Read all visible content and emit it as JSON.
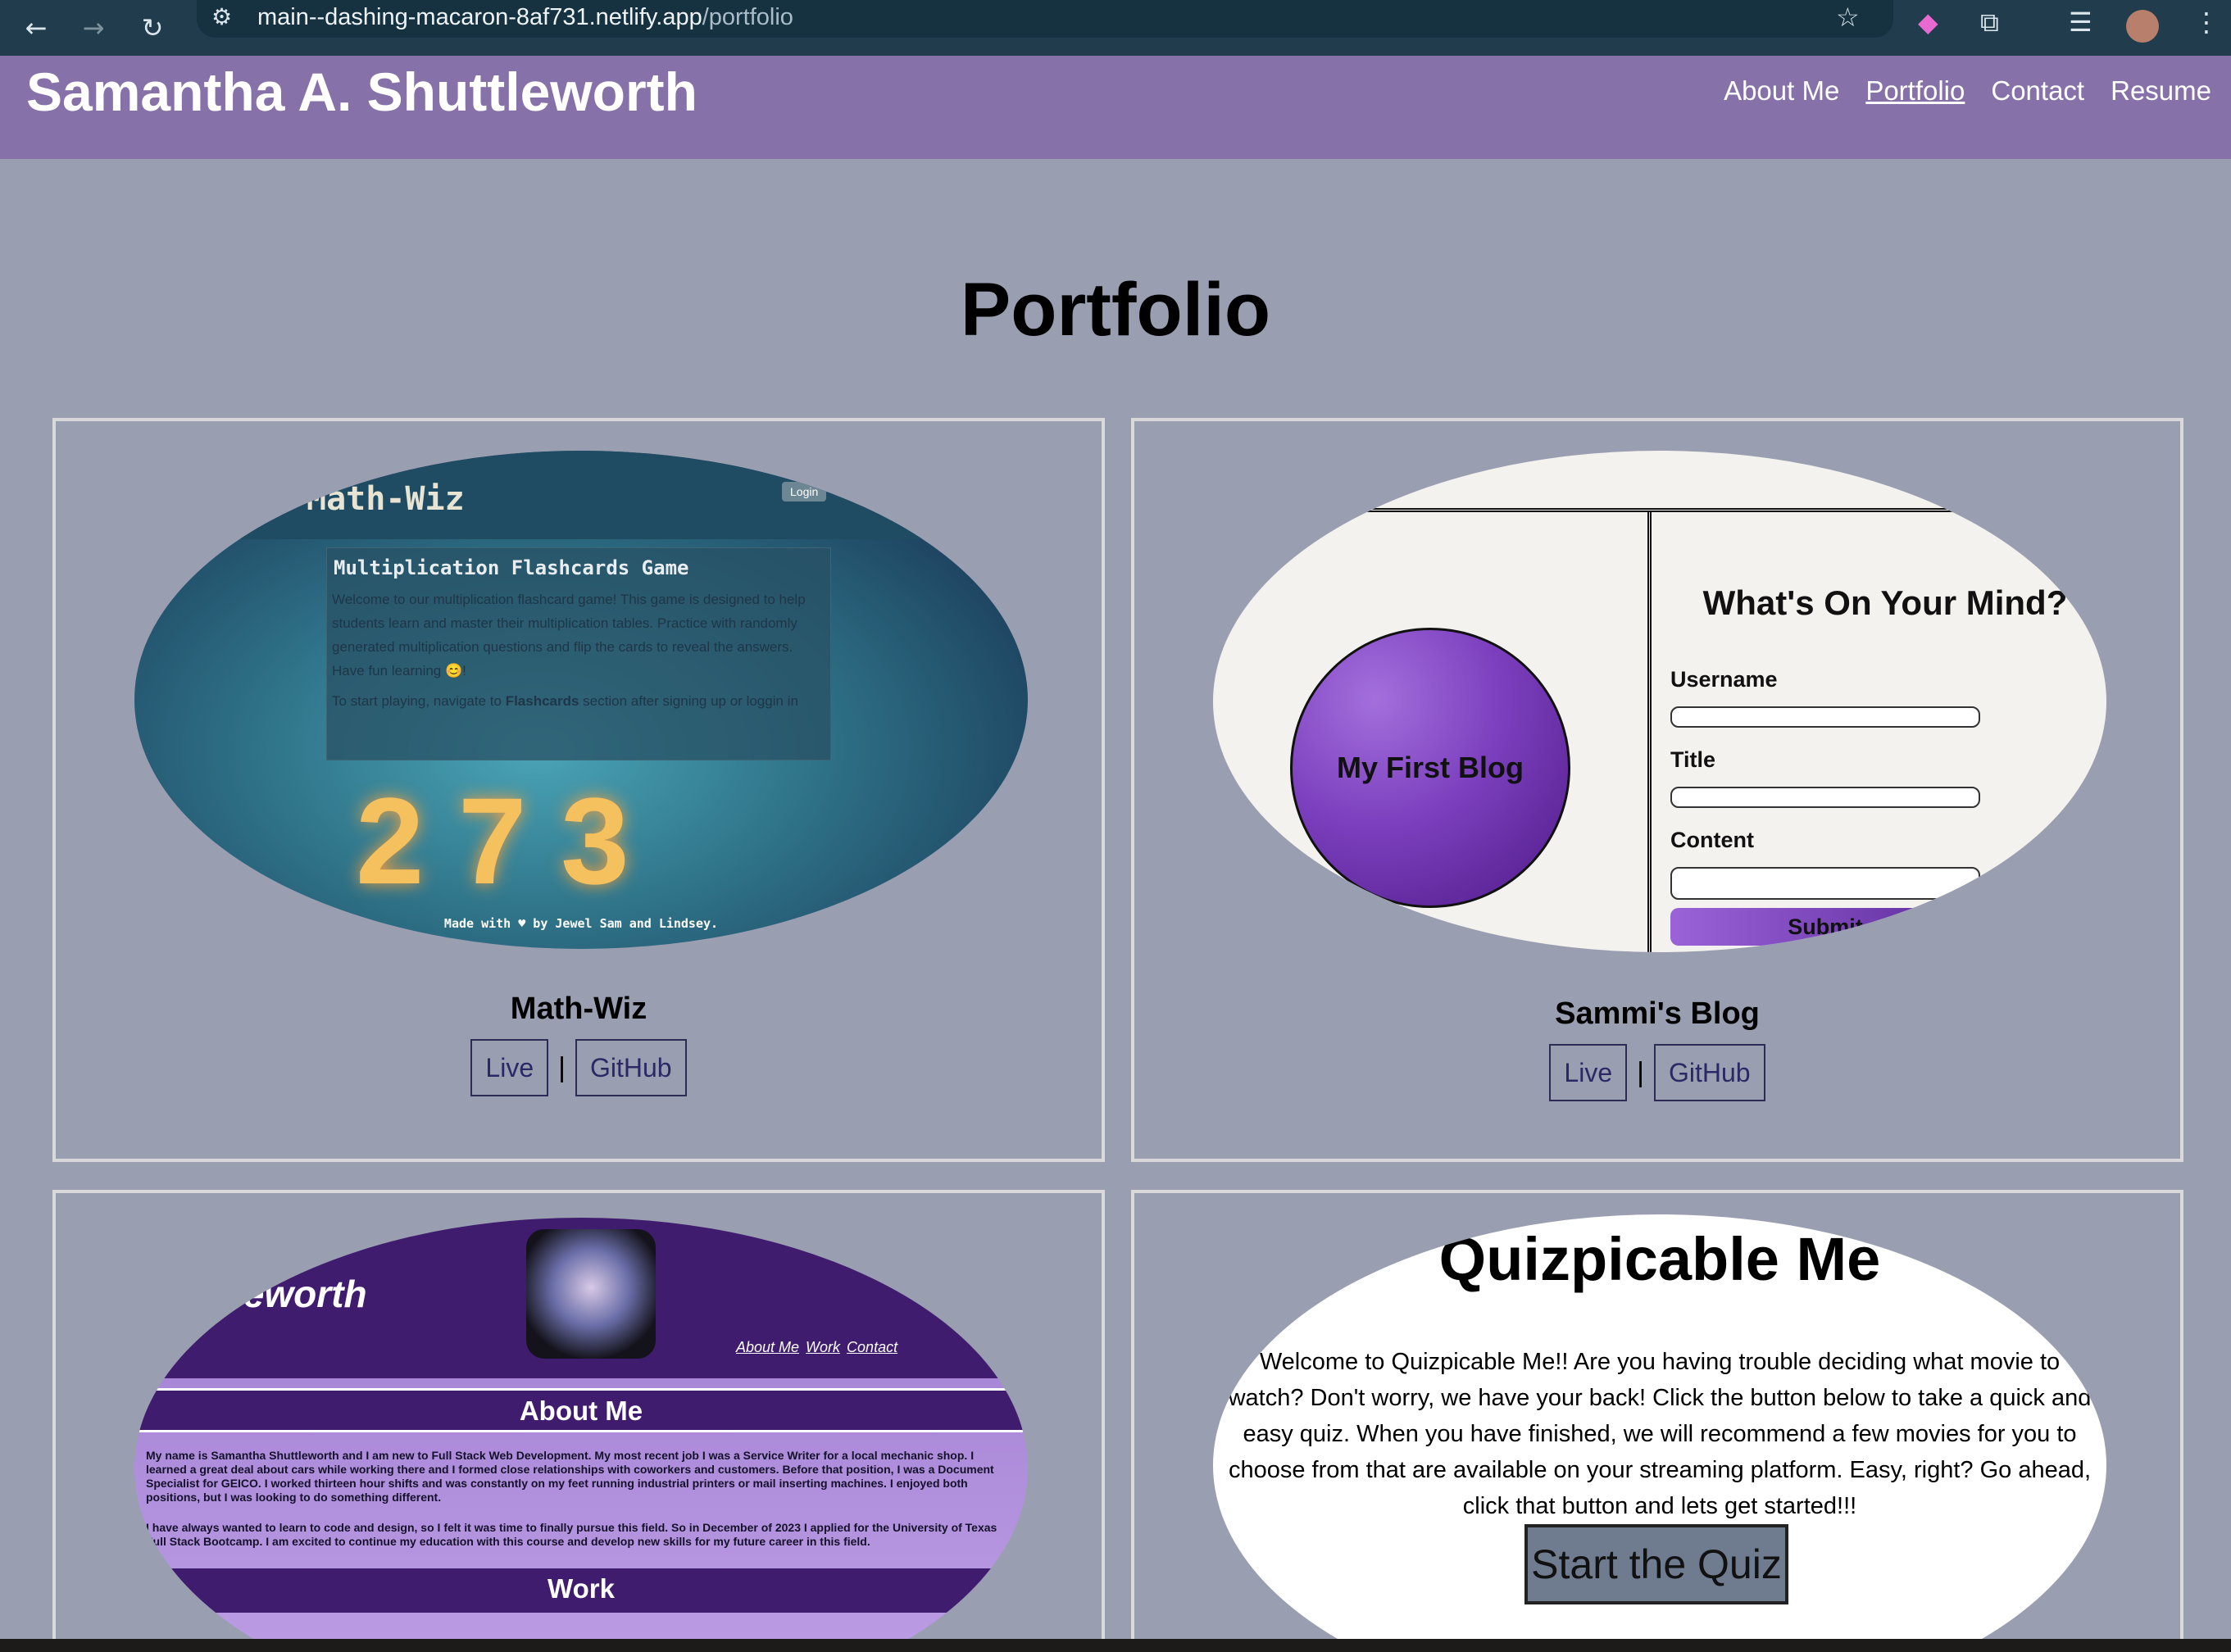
{
  "browser": {
    "url_host": "main--dashing-macaron-8af731.netlify.app",
    "url_path": "/portfolio"
  },
  "site": {
    "title": "Samantha A. Shuttleworth",
    "nav": [
      "About Me",
      "Portfolio",
      "Contact",
      "Resume"
    ],
    "active_nav": "Portfolio"
  },
  "page": {
    "heading": "Portfolio"
  },
  "projects": [
    {
      "title": "Math-Wiz",
      "live_label": "Live",
      "separator": "|",
      "github_label": "GitHub",
      "preview": {
        "app_name": "Math-Wiz",
        "login": "Login",
        "heading": "Multiplication Flashcards Game",
        "text1": "Welcome to our multiplication flashcard game! This game is designed to help students learn and master their multiplication tables. Practice with randomly generated multiplication questions and flip the cards to reveal the answers. Have fun learning 😊!",
        "text2_pre": "To start playing, navigate to ",
        "text2_strong": "Flashcards",
        "text2_post": " section after signing up or loggin in",
        "footer": "Made with ♥ by Jewel Sam and Lindsey."
      }
    },
    {
      "title": "Sammi's Blog",
      "live_label": "Live",
      "separator": "|",
      "github_label": "GitHub",
      "preview": {
        "circle_text": "My First Blog",
        "heading": "What's On Your Mind?",
        "username": "Username",
        "title": "Title",
        "content": "Content",
        "submit": "Submit"
      }
    },
    {
      "preview": {
        "name_fragment": "leworth",
        "links": [
          "About Me",
          "Work",
          "Contact"
        ],
        "about_heading": "About Me",
        "about_text1": "My name is Samantha Shuttleworth and I am new to Full Stack Web Development. My most recent job I was a Service Writer for a local mechanic shop. I learned a great deal about cars while working there and I formed close relationships with coworkers and customers. Before that position, I was a Document Specialist for GEICO. I worked thirteen hour shifts and was constantly on my feet running industrial printers or mail inserting machines. I enjoyed both positions, but I was looking to do something different.",
        "about_text2": "I have always wanted to learn to code and design, so I felt it was time to finally pursue this field. So in December of 2023 I applied for the University of Texas Full Stack Bootcamp. I am excited to continue my education with this course and develop new skills for my future career in this field.",
        "work_heading": "Work"
      }
    },
    {
      "preview": {
        "heading": "Quizpicable Me",
        "text": "Welcome to Quizpicable Me!! Are you having trouble deciding what movie to watch? Don't worry, we have your back! Click the button below to take a quick and easy quiz. When you have finished, we will recommend a few movies for you to choose from that are available on your streaming platform. Easy, right? Go ahead, click that button and lets get started!!!",
        "button": "Start the Quiz"
      }
    }
  ]
}
